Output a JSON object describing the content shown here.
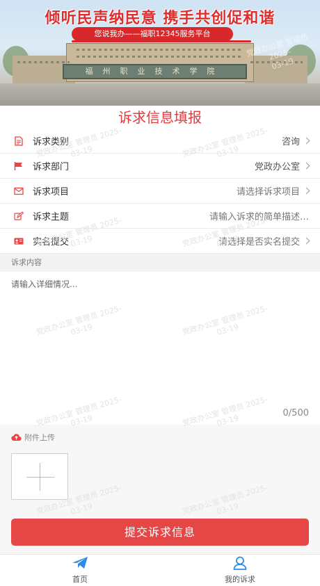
{
  "banner": {
    "slogan": "倾听民声纳民意 携手共创促和谐",
    "subtitle": "您说我办——福职12345服务平台",
    "plaque_text": "福州职业技术学院"
  },
  "watermark": {
    "line1": "党政办公室 管理员 2025-",
    "line2": "03-19"
  },
  "form": {
    "title": "诉求信息填报",
    "rows": [
      {
        "label": "诉求类别",
        "value": "咨询",
        "icon": "document-icon"
      },
      {
        "label": "诉求部门",
        "value": "党政办公室",
        "icon": "flag-icon"
      },
      {
        "label": "诉求项目",
        "value": "请选择诉求项目",
        "icon": "mail-icon"
      },
      {
        "label": "诉求主题",
        "value": "请输入诉求的简单描述…",
        "icon": "edit-icon"
      },
      {
        "label": "实名提交",
        "value": "请选择是否实名提交",
        "icon": "id-card-icon"
      }
    ]
  },
  "content": {
    "section_label": "诉求内容",
    "placeholder": "请输入详细情况...",
    "char_count": "0/500"
  },
  "attachments": {
    "label": "附件上传",
    "icon": "cloud-upload-icon"
  },
  "submit": {
    "label": "提交诉求信息"
  },
  "nav": {
    "items": [
      {
        "label": "首页",
        "icon": "paper-plane-icon"
      },
      {
        "label": "我的诉求",
        "icon": "user-icon"
      }
    ]
  },
  "colors": {
    "accent": "#e54646",
    "heading": "#e23b3b",
    "nav_icon": "#2b8be8"
  }
}
